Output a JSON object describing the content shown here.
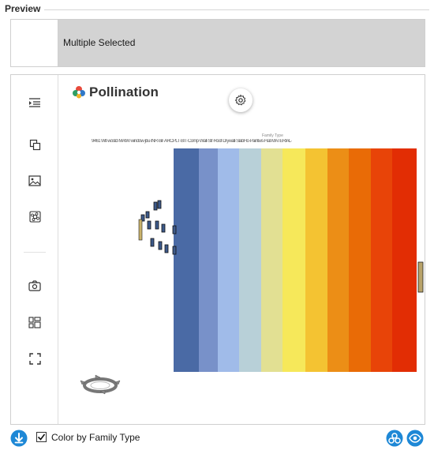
{
  "group": {
    "title": "Preview"
  },
  "selection": {
    "label": "Multiple Selected"
  },
  "toolbar": {
    "top_icons": [
      "indent-list-icon",
      "copy-layers-icon",
      "image-icon",
      "command-icon"
    ],
    "bottom_icons": [
      "camera-icon",
      "layout-icon",
      "fullscreen-icon"
    ]
  },
  "viewer": {
    "brand_name": "Pollination",
    "legend_title": "Family Type",
    "legend_labels": "9461 Wit·wostd·MAIW·window·jbu·INR·Bir·ARCPLT·BIT·Comp·Wall·Str·Roof·Drywall·SlabFlo·Paintws·Flat·MATERIAL·"
  },
  "colors": {
    "accent": "#1e88d6",
    "legend_bands": [
      "#4a6aa5",
      "#7891c9",
      "#a0bbe9",
      "#b8d0d8",
      "#e2e093",
      "#f6e85a",
      "#f4c332",
      "#ec8e16",
      "#e96b06",
      "#e84408",
      "#e22d04"
    ]
  },
  "bottom": {
    "checkbox_label": "Color by Family Type",
    "checkbox_checked": true
  }
}
